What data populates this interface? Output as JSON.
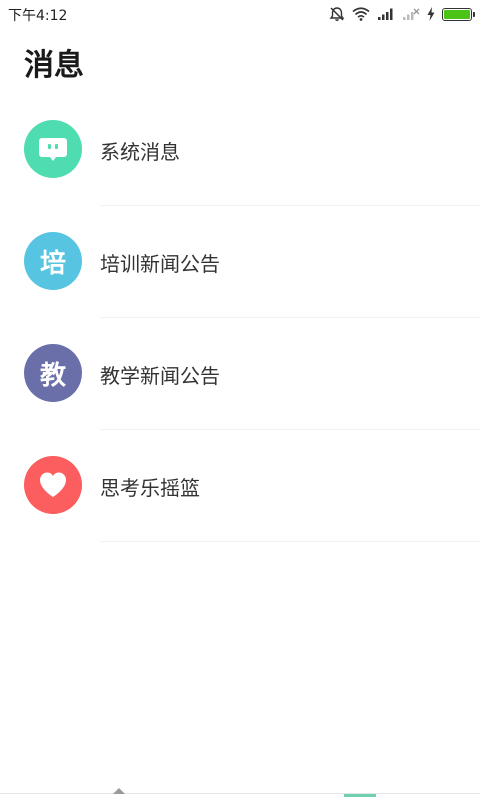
{
  "status_bar": {
    "time": "下午4:12",
    "battery_level": 1.0,
    "battery_color": "#4cc417",
    "icons": [
      "alarm-off-icon",
      "wifi-icon",
      "signal-icon",
      "signal-no-service-icon",
      "charging-icon",
      "battery-icon"
    ]
  },
  "header": {
    "title": "消息"
  },
  "messages": {
    "items": [
      {
        "label": "系统消息",
        "icon": "chat-bubble-icon",
        "icon_text": "",
        "color": "#4fdcb1"
      },
      {
        "label": "培训新闻公告",
        "icon": "pei-character-icon",
        "icon_text": "培",
        "color": "#57c4e1"
      },
      {
        "label": "教学新闻公告",
        "icon": "jiao-character-icon",
        "icon_text": "教",
        "color": "#6a6faa"
      },
      {
        "label": "思考乐摇篮",
        "icon": "heart-icon",
        "icon_text": "",
        "color": "#fc5d5e"
      }
    ]
  }
}
